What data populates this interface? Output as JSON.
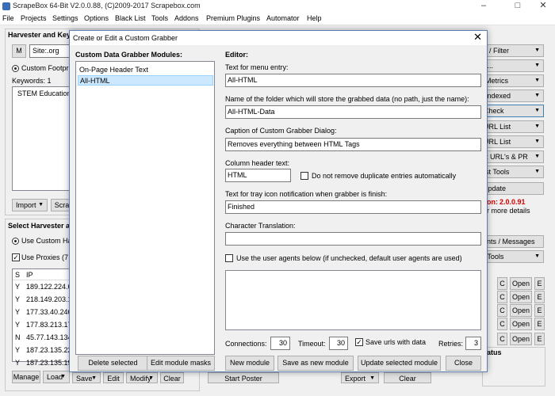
{
  "app": {
    "title": "ScrapeBox 64-Bit V2.0.0.88, (C)2009-2017 Scrapebox.com"
  },
  "menubar": [
    "File",
    "Projects",
    "Settings",
    "Options",
    "Black List",
    "Tools",
    "Addons",
    "Premium Plugins",
    "Automator",
    "Help"
  ],
  "harvester": {
    "heading": "Harvester and Keyw",
    "m_button": "M",
    "site_field": "Site:.org",
    "custom_footprint_label": "Custom Footpr",
    "keywords_label": "Keywords:  1",
    "keywords_list": [
      "STEM Education"
    ],
    "import_button": "Import",
    "scrape_button": "Scra"
  },
  "select_harvester": {
    "heading": "Select Harvester ar",
    "use_custom_label": "Use Custom Ha",
    "use_proxies_label": "Use Proxies  (7",
    "columns": [
      "S",
      "IP"
    ],
    "rows": [
      {
        "s": "Y",
        "ip": "189.122.224.6"
      },
      {
        "s": "Y",
        "ip": "218.149.203.1"
      },
      {
        "s": "Y",
        "ip": "177.33.40.246"
      },
      {
        "s": "Y",
        "ip": "177.83.213.17"
      },
      {
        "s": "N",
        "ip": "45.77.143.134"
      },
      {
        "s": "Y",
        "ip": "187.23.135.22"
      },
      {
        "s": "Y",
        "ip": "187.23.135.19"
      }
    ],
    "bottom_buttons": {
      "manage": "Manage",
      "load": "Load",
      "save": "Save",
      "edit": "Edit",
      "modify": "Modify",
      "clear": "Clear"
    }
  },
  "right_panel": {
    "buttons": [
      "ve / Filter",
      "im...",
      "k Metrics",
      "k Indexed",
      "/ Check",
      "t URL List",
      "t URL List",
      "ort URL's & PR",
      "List Tools"
    ],
    "update_button": "Update",
    "version_label": "on:",
    "version_value": "2.0.0.91",
    "more_details": "r more details",
    "comments_button": "ents / Messages",
    "list_tools_button": "st Tools",
    "open_rows": [
      {
        "c": "C",
        "open": "Open",
        "e": "E"
      },
      {
        "c": "C",
        "open": "Open",
        "e": "E"
      },
      {
        "c": "C",
        "open": "Open",
        "e": "E"
      },
      {
        "c": "C",
        "open": "Open",
        "e": "E"
      },
      {
        "c": "C",
        "open": "Open",
        "e": "E"
      }
    ],
    "status_label": "atus"
  },
  "bottom_strip": {
    "start_poster": "Start Poster",
    "export": "Export",
    "clear": "Clear"
  },
  "dialog": {
    "title": "Create or Edit a Custom Grabber",
    "modules_heading": "Custom Data Grabber Modules:",
    "modules": [
      {
        "label": "On-Page Header Text",
        "selected": false
      },
      {
        "label": "All-HTML",
        "selected": true
      }
    ],
    "editor_heading": "Editor:",
    "menu_entry_label": "Text for menu entry:",
    "menu_entry_value": "All-HTML",
    "folder_label": "Name of the folder which will store the grabbed data  (no path, just the name):",
    "folder_value": "All-HTML-Data",
    "caption_label": "Caption of Custom Grabber Dialog:",
    "caption_value": "Removes everything between HTML Tags",
    "column_header_label": "Column header text:",
    "column_header_value": "HTML",
    "no_remove_duplicates_label": "Do not remove duplicate entries automatically",
    "no_remove_duplicates_checked": false,
    "tray_label": "Text for tray icon notification when grabber is finish:",
    "tray_value": "Finished",
    "char_translation_label": "Character Translation:",
    "char_translation_value": "",
    "user_agents_label": "Use the user agents below (if unchecked, default user agents are used)",
    "user_agents_checked": false,
    "user_agents_text": "",
    "connections_label": "Connections:",
    "connections_value": "30",
    "timeout_label": "Timeout:",
    "timeout_value": "30",
    "save_urls_label": "Save urls with data",
    "save_urls_checked": true,
    "retries_label": "Retries:",
    "retries_value": "3",
    "buttons": {
      "delete_selected": "Delete selected",
      "edit_module_masks": "Edit module masks",
      "new_module": "New module",
      "save_as_new": "Save as new module",
      "update_selected": "Update selected module",
      "close": "Close"
    }
  },
  "colors": {
    "selection": "#cce8ff",
    "version_red": "#d40000",
    "dialog_border": "#5a7fb5"
  }
}
